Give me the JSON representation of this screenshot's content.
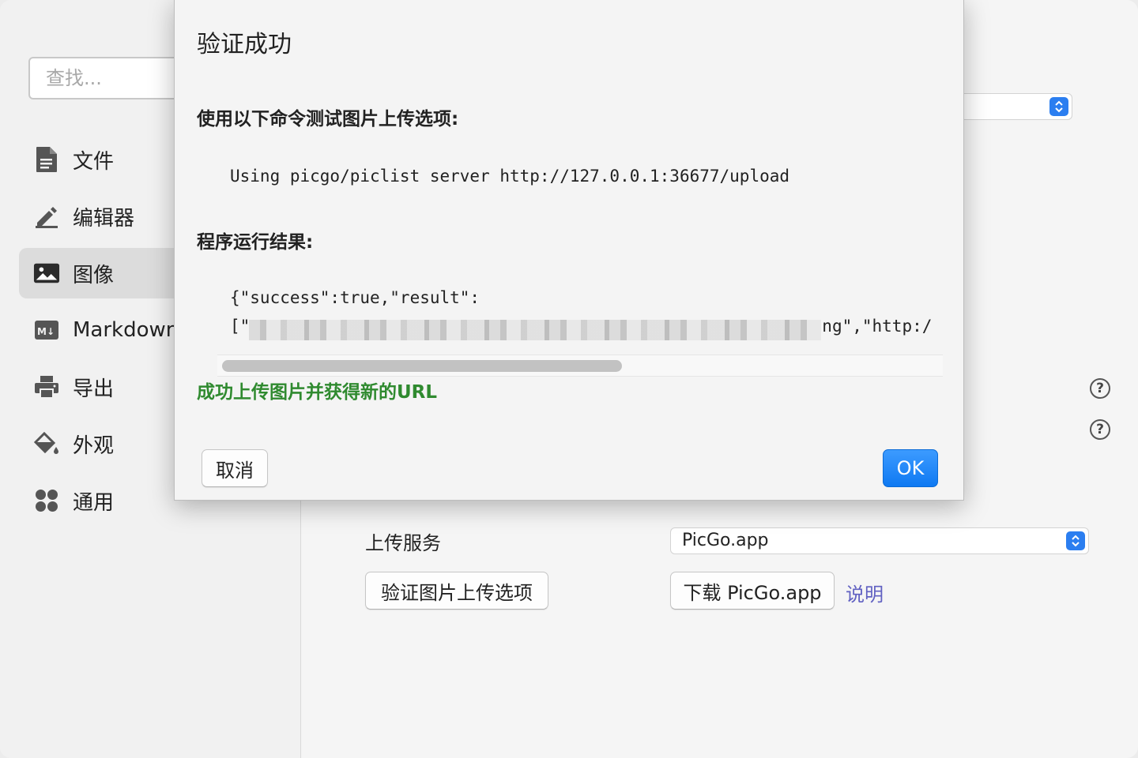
{
  "sidebar": {
    "search_placeholder": "查找...",
    "items": [
      {
        "label": "文件",
        "icon": "document-icon"
      },
      {
        "label": "编辑器",
        "icon": "pencil-icon"
      },
      {
        "label": "图像",
        "icon": "image-icon",
        "active": true
      },
      {
        "label": "Markdown",
        "icon": "markdown-icon"
      },
      {
        "label": "导出",
        "icon": "printer-icon"
      },
      {
        "label": "外观",
        "icon": "paint-bucket-icon"
      },
      {
        "label": "通用",
        "icon": "grid-icon"
      }
    ]
  },
  "main": {
    "upload_service_label": "上传服务",
    "upload_service_value": "PicGo.app",
    "verify_button": "验证图片上传选项",
    "download_button": "下载 PicGo.app",
    "help_link": "说明"
  },
  "dialog": {
    "title": "验证成功",
    "test_heading": "使用以下命令测试图片上传选项:",
    "command": "Using picgo/piclist server http://127.0.0.1:36677/upload",
    "result_heading": "程序运行结果:",
    "result_line1": "{\"success\":true,\"result\":",
    "result_line2_start": "[\"",
    "result_line2_end": "ng\",\"http:/",
    "success_message": "成功上传图片并获得新的URL",
    "cancel_button": "取消",
    "ok_button": "OK"
  },
  "colors": {
    "accent": "#0f79f2",
    "success": "#2f8a2f",
    "link": "#6161c2",
    "close": "#fe5f57"
  }
}
